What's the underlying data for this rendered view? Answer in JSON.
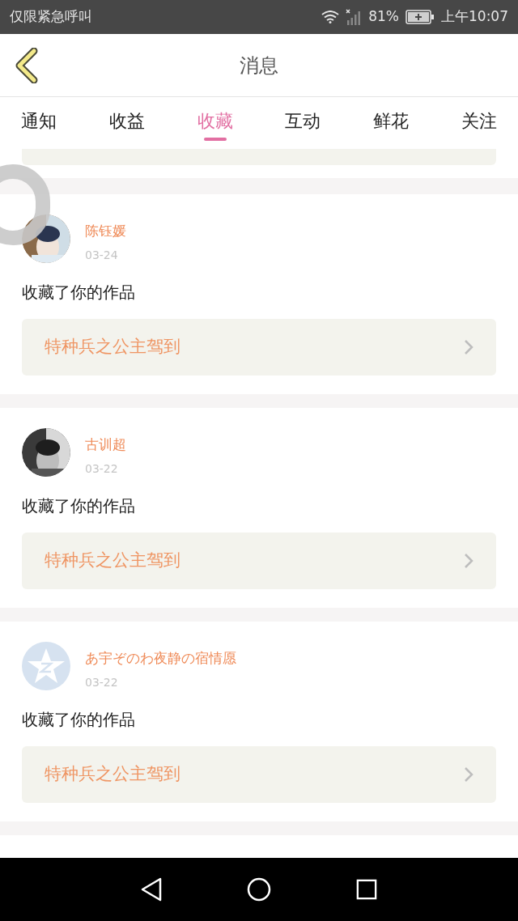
{
  "status_bar": {
    "carrier": "仅限紧急呼叫",
    "battery": "81%",
    "time": "上午10:07"
  },
  "header": {
    "title": "消息"
  },
  "tabs": [
    {
      "label": "通知",
      "selected": false
    },
    {
      "label": "收益",
      "selected": false
    },
    {
      "label": "收藏",
      "selected": true
    },
    {
      "label": "互动",
      "selected": false
    },
    {
      "label": "鲜花",
      "selected": false
    },
    {
      "label": "关注",
      "selected": false
    }
  ],
  "messages": [
    {
      "name": "陈钰媛",
      "date": "03-24",
      "action": "收藏了你的作品",
      "work": "特种兵之公主驾到"
    },
    {
      "name": "古训超",
      "date": "03-22",
      "action": "收藏了你的作品",
      "work": "特种兵之公主驾到"
    },
    {
      "name": "あ宇ぞのわ夜静の宿情愿",
      "date": "03-22",
      "action": "收藏了你的作品",
      "work": "特种兵之公主驾到",
      "kind": "default"
    }
  ]
}
